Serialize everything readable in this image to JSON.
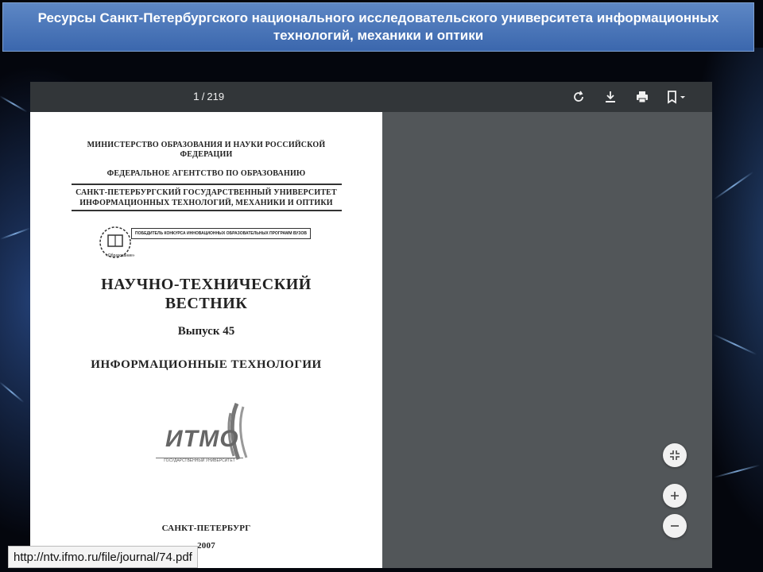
{
  "slide": {
    "title_line1": "Ресурсы Санкт-Петербургского национального исследовательского университета информационных",
    "title_line2": "технологий, механики и оптики",
    "url": "http://ntv.ifmo.ru/file/journal/74.pdf"
  },
  "viewer": {
    "current_page": "1",
    "page_separator": "/",
    "total_pages": "219",
    "icons": [
      "rotate-icon",
      "download-icon",
      "print-icon",
      "bookmark-icon",
      "fit-page-icon",
      "zoom-in-icon",
      "zoom-out-icon"
    ]
  },
  "document": {
    "ministry_line1": "МИНИСТЕРСТВО ОБРАЗОВАНИЯ И НАУКИ РОССИЙСКОЙ",
    "ministry_line2": "ФЕДЕРАЦИИ",
    "agency": "ФЕДЕРАЛЬНОЕ АГЕНТСТВО ПО ОБРАЗОВАНИЮ",
    "university_line1": "САНКТ-ПЕТЕРБУРГСКИЙ ГОСУДАРСТВЕННЫЙ УНИВЕРСИТЕТ",
    "university_line2": "ИНФОРМАЦИОННЫХ ТЕХНОЛОГИЙ, МЕХАНИКИ И ОПТИКИ",
    "contest_banner": "ПОБЕДИТЕЛЬ КОНКУРСА ИННОВАЦИОННЫХ ОБРАЗОВАТЕЛЬНЫХ ПРОГРАММ ВУЗОВ",
    "emblem_caption": "«Образование»",
    "journal_line1": "НАУЧНО-ТЕХНИЧЕСКИЙ",
    "journal_line2": "ВЕСТНИК",
    "issue": "Выпуск 45",
    "topic": "ИНФОРМАЦИОННЫЕ ТЕХНОЛОГИИ",
    "logo_text": "ИТМО",
    "logo_caption": "ГОСУДАРСТВЕННЫЙ УНИВЕРСИТЕТ",
    "city": "САНКТ-ПЕТЕРБУРГ",
    "year": "2007"
  }
}
